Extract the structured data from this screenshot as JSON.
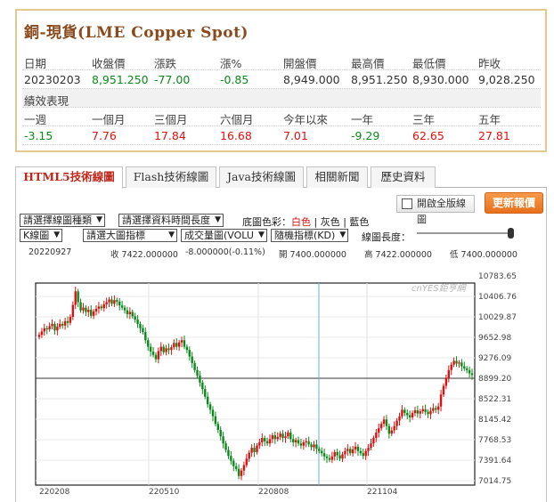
{
  "quote": {
    "title": "銅-現貨(LME Copper Spot)",
    "headers": [
      "日期",
      "收盤價",
      "漲跌",
      "漲%",
      "開盤價",
      "最高價",
      "最低價",
      "昨收"
    ],
    "values": [
      "20230203",
      "8,951.250",
      "-77.00",
      "-0.85",
      "8,949.000",
      "8,951.250",
      "8,930.000",
      "9,028.250"
    ],
    "perf_title": "績效表現",
    "perf_headers": [
      "一週",
      "一個月",
      "三個月",
      "六個月",
      "今年以來",
      "一年",
      "三年",
      "五年"
    ],
    "perf_values": [
      "-3.15",
      "7.76",
      "17.84",
      "16.68",
      "7.01",
      "-9.29",
      "62.65",
      "27.81"
    ]
  },
  "tabs": [
    "HTML5技術線圖",
    "Flash技術線圖",
    "Java技術線圖",
    "相關新聞",
    "歷史資料"
  ],
  "toolbar": {
    "full_chart_label": "開啟全版線圖",
    "refresh_label": "更新報價"
  },
  "controls": {
    "chart_type": "請選擇線圖種類",
    "time_range": "請選擇資料時間長度",
    "bg_label": "底圖色彩：",
    "bg_white": "白色",
    "bg_sep1": " | ",
    "bg_gray": "灰色",
    "bg_sep2": " | ",
    "bg_blue": "藍色",
    "period": "K線圖",
    "main_indicator": "請選大圖指標",
    "volume": "成交量圖(VOLU",
    "random": "隨機指標(KD)",
    "line_length": "線圖長度："
  },
  "info": {
    "date": "20220927",
    "close": "收 7422.000000",
    "change": "-8.000000(-0.11%)",
    "open": "開 7400.000000",
    "high": "高 7422.000000",
    "low": "低 7400.000000"
  },
  "chart_data": {
    "type": "candlestick",
    "watermark": "cnYES鉅亨網",
    "y_ticks": [
      "10783.65",
      "10406.76",
      "10029.87",
      "9652.98",
      "9276.09",
      "8899.20",
      "8522.31",
      "8145.42",
      "7768.53",
      "7391.64",
      "7014.75"
    ],
    "x_ticks": [
      "220208",
      "220510",
      "220808",
      "221104"
    ],
    "ylim": [
      7014.75,
      10783.65
    ],
    "crosshair_price": 8899.2,
    "colors": {
      "up": "#e01010",
      "down": "#0a8a1a",
      "crosshair": "#6aaee0"
    },
    "closes": [
      9700,
      9760,
      9820,
      9800,
      9860,
      9900,
      9780,
      9850,
      9900,
      9870,
      9950,
      9920,
      10030,
      10250,
      10500,
      10300,
      10150,
      10200,
      10120,
      10160,
      10050,
      10130,
      10180,
      10220,
      10190,
      10260,
      10300,
      10350,
      10270,
      10340,
      10310,
      10240,
      10200,
      10150,
      10080,
      10120,
      10040,
      9980,
      9900,
      9820,
      9750,
      9600,
      9480,
      9390,
      9330,
      9250,
      9400,
      9480,
      9380,
      9450,
      9420,
      9470,
      9550,
      9480,
      9560,
      9600,
      9480,
      9420,
      9300,
      9180,
      9050,
      8950,
      8820,
      8700,
      8560,
      8420,
      8320,
      8200,
      8060,
      7950,
      7830,
      7700,
      7580,
      7470,
      7380,
      7280,
      7230,
      7100,
      7200,
      7300,
      7420,
      7530,
      7620,
      7540,
      7660,
      7720,
      7800,
      7740,
      7700,
      7780,
      7850,
      7780,
      7820,
      7880,
      7800,
      7830,
      7900,
      7780,
      7720,
      7760,
      7700,
      7660,
      7720,
      7740,
      7680,
      7630,
      7680,
      7600,
      7560,
      7520,
      7460,
      7430,
      7400,
      7460,
      7540,
      7480,
      7420,
      7500,
      7560,
      7600,
      7520,
      7590,
      7640,
      7560,
      7520,
      7470,
      7560,
      7620,
      7700,
      7800,
      7900,
      7980,
      8060,
      8140,
      8020,
      7880,
      7940,
      8020,
      8120,
      8200,
      8320,
      8260,
      8220,
      8180,
      8260,
      8310,
      8250,
      8290,
      8330,
      8280,
      8240,
      8300,
      8350,
      8320,
      8380,
      8600,
      8760,
      8900,
      9050,
      9150,
      9220,
      9170,
      9190,
      9120,
      9080,
      9050,
      8990,
      8960
    ]
  }
}
